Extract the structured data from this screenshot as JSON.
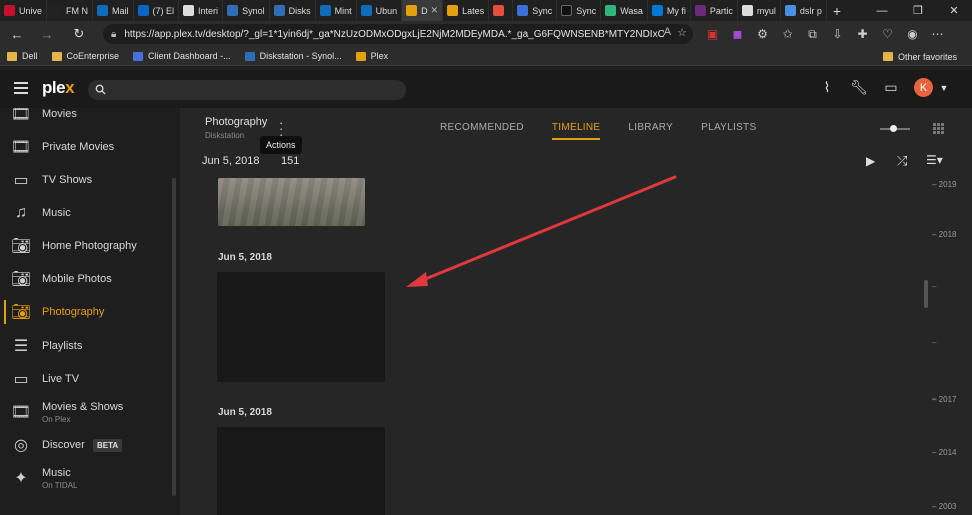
{
  "browser": {
    "tabs": [
      {
        "label": "Unive",
        "color": "#c8102e"
      },
      {
        "label": "FM N",
        "color": "#222222"
      },
      {
        "label": "Mail",
        "color": "#0f6cbd"
      },
      {
        "label": "(7) El",
        "color": "#0a66c2"
      },
      {
        "label": "Interi",
        "color": "#dddddd"
      },
      {
        "label": "Synol",
        "color": "#2f6db5"
      },
      {
        "label": "Disks",
        "color": "#2f6db5"
      },
      {
        "label": "Mint",
        "color": "#0f6cbd"
      },
      {
        "label": "Ubun",
        "color": "#0f6cbd"
      },
      {
        "label": "D",
        "color": "#e5a00d"
      },
      {
        "label": "Lates",
        "color": "#e5a00d"
      },
      {
        "label": "",
        "color": "#e74c3c"
      },
      {
        "label": "Sync",
        "color": "#3b6fd8"
      },
      {
        "label": "Sync",
        "color": "#111111"
      },
      {
        "label": "Wasa",
        "color": "#2eb67d"
      },
      {
        "label": "My fi",
        "color": "#0078d4"
      },
      {
        "label": "Partic",
        "color": "#6b2a7b"
      },
      {
        "label": "myul",
        "color": "#dddddd"
      },
      {
        "label": "dslr p",
        "color": "#4a90e2"
      }
    ],
    "new_tab": "+",
    "url": "https://app.plex.tv/desktop/?_gl=1*1yin6dj*_ga*NzUzODMxODgxLjE2NjM2MDEyMDA.*_ga_G6FQWNSENB*MTY2NDIxOTYx...",
    "bookmarks": [
      {
        "label": "Dell",
        "color": "#e5b54a"
      },
      {
        "label": "CoEnterprise",
        "color": "#e5b54a"
      },
      {
        "label": "Client Dashboard -...",
        "color": "#4a6ee0"
      },
      {
        "label": "Diskstation - Synol...",
        "color": "#2f6db5"
      },
      {
        "label": "Plex",
        "color": "#e5a00d"
      }
    ],
    "other_favorites": "Other favorites"
  },
  "plex": {
    "logo_text": "plex",
    "avatar_letter": "K",
    "sidebar": [
      {
        "label": "Movies",
        "icon": "film-icon",
        "sub": ""
      },
      {
        "label": "Private Movies",
        "icon": "film-icon",
        "sub": ""
      },
      {
        "label": "TV Shows",
        "icon": "tv-icon",
        "sub": ""
      },
      {
        "label": "Music",
        "icon": "music-icon",
        "sub": ""
      },
      {
        "label": "Home Photography",
        "icon": "camera-icon",
        "sub": ""
      },
      {
        "label": "Mobile Photos",
        "icon": "camera-icon",
        "sub": ""
      },
      {
        "label": "Photography",
        "icon": "camera-icon",
        "sub": ""
      },
      {
        "label": "Playlists",
        "icon": "playlist-icon",
        "sub": ""
      },
      {
        "label": "Live TV",
        "icon": "live-tv-icon",
        "sub": ""
      },
      {
        "label": "Movies & Shows",
        "icon": "film-icon",
        "sub": "On Plex"
      },
      {
        "label": "Discover",
        "icon": "compass-icon",
        "sub": ""
      },
      {
        "label": "Music",
        "icon": "tidal-icon",
        "sub": "On TIDAL"
      }
    ],
    "beta_label": "BETA",
    "library_title": "Photography",
    "library_server": "Diskstation",
    "tooltip": "Actions",
    "tabs": [
      "RECOMMENDED",
      "TIMELINE",
      "LIBRARY",
      "PLAYLISTS"
    ],
    "date_header": "Jun 5, 2018",
    "count": "151",
    "sections": [
      "Jun 5, 2018",
      "Jun 5, 2018"
    ],
    "timeline": [
      {
        "label": "– 2019",
        "top": 0
      },
      {
        "label": "– 2018",
        "top": 0
      },
      {
        "label": "–",
        "top": 0
      },
      {
        "label": "–",
        "top": 0
      },
      {
        "label": "–",
        "top": 0
      },
      {
        "label": "– 2017",
        "top": 0
      },
      {
        "label": "– 2014",
        "top": 0
      },
      {
        "label": "– 2003",
        "top": 0
      }
    ],
    "accent": "#e5a00d"
  }
}
